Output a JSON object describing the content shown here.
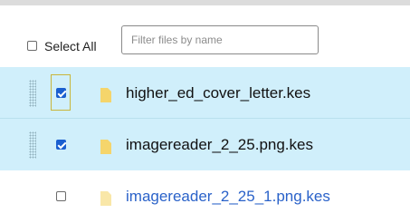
{
  "toolbar": {
    "select_all_label": "Select All",
    "select_all_checked": false,
    "filter_placeholder": "Filter files by name",
    "filter_value": ""
  },
  "files": [
    {
      "name": "higher_ed_cover_letter.kes",
      "checked": true,
      "selected": true,
      "focused": true,
      "icon": "folder-icon"
    },
    {
      "name": "imagereader_2_25.png.kes",
      "checked": true,
      "selected": true,
      "focused": false,
      "icon": "folder-icon"
    },
    {
      "name": "imagereader_2_25_1.png.kes",
      "checked": false,
      "selected": false,
      "focused": false,
      "icon": "folder-icon"
    }
  ],
  "colors": {
    "selected_row": "#d0effb",
    "checkbox_checked": "#1a5fd0",
    "folder_icon": "#f5d56b",
    "folder_icon_light": "#f9e7a8",
    "link_text": "#2a62c9",
    "focus_outline": "#c9b53a"
  }
}
